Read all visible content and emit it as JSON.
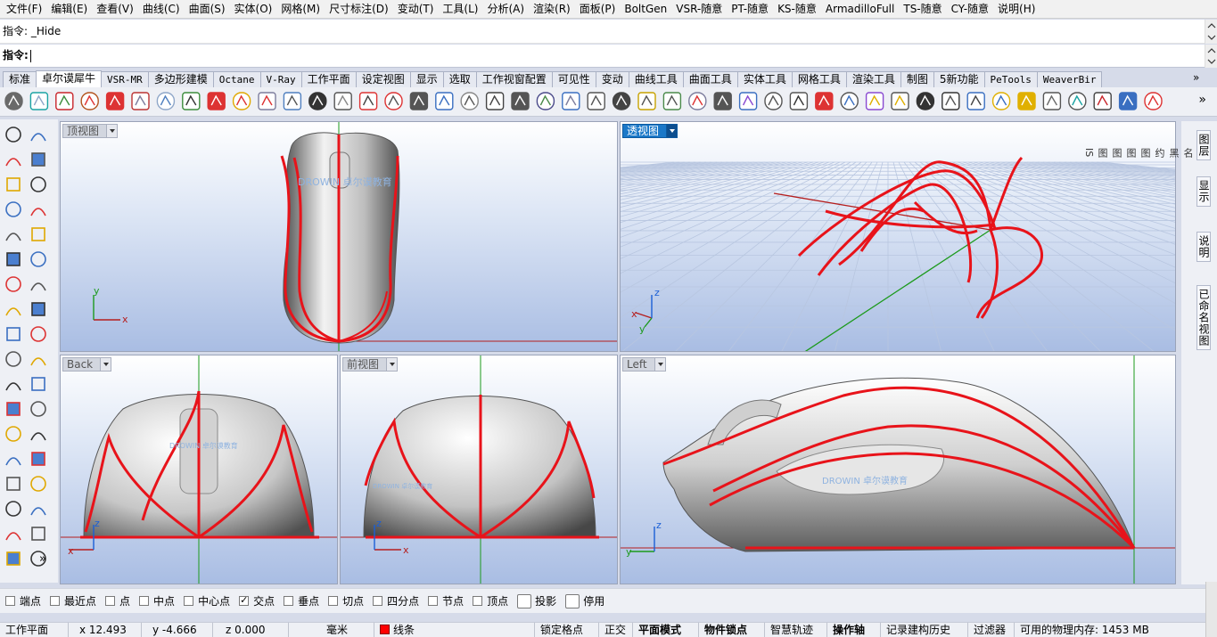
{
  "menu": [
    "文件(F)",
    "编辑(E)",
    "查看(V)",
    "曲线(C)",
    "曲面(S)",
    "实体(O)",
    "网格(M)",
    "尺寸标注(D)",
    "变动(T)",
    "工具(L)",
    "分析(A)",
    "渲染(R)",
    "面板(P)",
    "BoltGen",
    "VSR-随意",
    "PT-随意",
    "KS-随意",
    "ArmadilloFull",
    "TS-随意",
    "CY-随意",
    "说明(H)"
  ],
  "command": {
    "history": "指令: _Hide",
    "prompt": "指令:"
  },
  "tabs": [
    {
      "label": "标准",
      "active": false,
      "mono": false
    },
    {
      "label": "卓尔谟犀牛",
      "active": true,
      "mono": false
    },
    {
      "label": "VSR-MR",
      "active": false,
      "mono": true
    },
    {
      "label": "多边形建模",
      "active": false,
      "mono": false
    },
    {
      "label": "Octane",
      "active": false,
      "mono": true
    },
    {
      "label": "V-Ray",
      "active": false,
      "mono": true
    },
    {
      "label": "工作平面",
      "active": false,
      "mono": false
    },
    {
      "label": "设定视图",
      "active": false,
      "mono": false
    },
    {
      "label": "显示",
      "active": false,
      "mono": false
    },
    {
      "label": "选取",
      "active": false,
      "mono": false
    },
    {
      "label": "工作视窗配置",
      "active": false,
      "mono": false
    },
    {
      "label": "可见性",
      "active": false,
      "mono": false
    },
    {
      "label": "变动",
      "active": false,
      "mono": false
    },
    {
      "label": "曲线工具",
      "active": false,
      "mono": false
    },
    {
      "label": "曲面工具",
      "active": false,
      "mono": false
    },
    {
      "label": "实体工具",
      "active": false,
      "mono": false
    },
    {
      "label": "网格工具",
      "active": false,
      "mono": false
    },
    {
      "label": "渲染工具",
      "active": false,
      "mono": false
    },
    {
      "label": "制图",
      "active": false,
      "mono": false
    },
    {
      "label": "5新功能",
      "active": false,
      "mono": false
    },
    {
      "label": "PeTools",
      "active": false,
      "mono": true
    },
    {
      "label": "WeaverBir",
      "active": false,
      "mono": true
    }
  ],
  "tabs_more": "»",
  "toolbar_more": "»",
  "viewports": {
    "top": {
      "label": "顶视图",
      "active": false,
      "watermark": "DROWIN 卓尔谟教育"
    },
    "perspective": {
      "label": "透视图",
      "active": true
    },
    "back": {
      "label": "Back",
      "active": false,
      "watermark": "DROWIN 卓尔谟教育"
    },
    "front": {
      "label": "前视图",
      "active": false,
      "watermark": "DROWIN 卓尔谟教育"
    },
    "left": {
      "label": "Left",
      "active": false,
      "watermark": "DROWIN 卓尔谟教育"
    }
  },
  "axes": {
    "x": "x",
    "y": "y",
    "z": "z"
  },
  "right_panel": {
    "tabs": [
      "图层",
      "显示",
      "说明",
      "已命名视图"
    ],
    "column_text": [
      "名",
      "黑",
      "约",
      "图",
      "图",
      "图",
      "图",
      "IS"
    ]
  },
  "osnaps": [
    {
      "label": "端点",
      "checked": false
    },
    {
      "label": "最近点",
      "checked": false
    },
    {
      "label": "点",
      "checked": false
    },
    {
      "label": "中点",
      "checked": false
    },
    {
      "label": "中心点",
      "checked": false
    },
    {
      "label": "交点",
      "checked": true
    },
    {
      "label": "垂点",
      "checked": false
    },
    {
      "label": "切点",
      "checked": false
    },
    {
      "label": "四分点",
      "checked": false
    },
    {
      "label": "节点",
      "checked": false
    },
    {
      "label": "顶点",
      "checked": false
    }
  ],
  "osnap_extra": [
    {
      "label": "投影",
      "checked": false
    },
    {
      "label": "停用",
      "checked": false
    }
  ],
  "status": {
    "cplane": "工作平面",
    "x": "x 12.493",
    "y": "y -4.666",
    "z": "z 0.000",
    "unit": "毫米",
    "layer": "线条",
    "layer_color": "#ff0000",
    "grid_snap": "锁定格点",
    "ortho": "正交",
    "planar": "平面模式",
    "osnap": "物件锁点",
    "smarttrack": "智慧轨迹",
    "gumball": "操作轴",
    "history": "记录建构历史",
    "filter": "过滤器",
    "memory": "可用的物理内存: 1453 MB"
  },
  "colors": {
    "curve_red": "#e8131a",
    "active_viewport": "#1b78c8",
    "x_axis": "#b51e1e",
    "y_axis": "#1c9a1c"
  }
}
